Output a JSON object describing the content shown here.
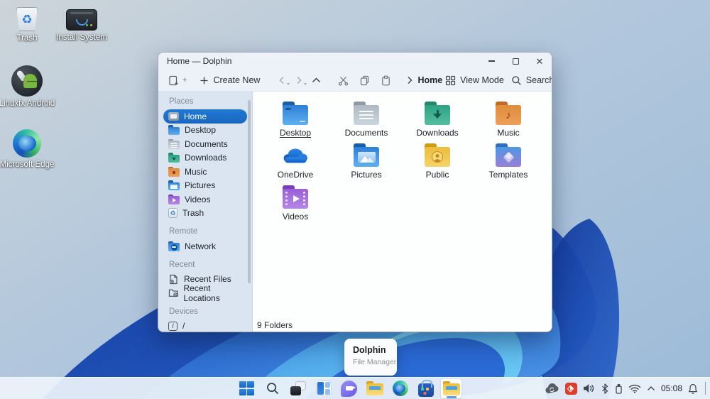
{
  "desktop": {
    "icons": [
      {
        "label": "Trash",
        "icon": "trash-icon"
      },
      {
        "label": "Install System",
        "icon": "install-system-icon"
      },
      {
        "label": "Linuxfx Android",
        "icon": "linuxfx-android-icon"
      },
      {
        "label": "Microsoft Edge",
        "icon": "edge-icon"
      }
    ]
  },
  "window": {
    "title": "Home — Dolphin",
    "controls": {
      "minimize": "minimize",
      "maximize": "maximize",
      "close": "close"
    },
    "toolbar": {
      "new_tab_icon": "new-folder-tab-icon",
      "create_new_label": "Create New",
      "nav_icons": [
        "back-chevron-icon",
        "forward-chevron-icon",
        "up-arrow-icon"
      ],
      "edit_icons": [
        "cut-scissors-icon",
        "copy-icon",
        "paste-icon"
      ],
      "breadcrumb": {
        "location": "Home"
      },
      "view_mode_label": "View Mode",
      "search_label": "Search",
      "menu_icon": "meatballs-menu-icon"
    },
    "sidebar": {
      "sections": [
        {
          "title": "Places",
          "items": [
            {
              "label": "Home",
              "icon": "home-icon",
              "selected": true
            },
            {
              "label": "Desktop",
              "icon": "folder-desktop-icon"
            },
            {
              "label": "Documents",
              "icon": "folder-documents-icon"
            },
            {
              "label": "Downloads",
              "icon": "folder-downloads-icon"
            },
            {
              "label": "Music",
              "icon": "folder-music-icon"
            },
            {
              "label": "Pictures",
              "icon": "folder-pictures-icon"
            },
            {
              "label": "Videos",
              "icon": "folder-videos-icon"
            },
            {
              "label": "Trash",
              "icon": "trash-small-icon"
            }
          ]
        },
        {
          "title": "Remote",
          "items": [
            {
              "label": "Network",
              "icon": "network-folder-icon"
            }
          ]
        },
        {
          "title": "Recent",
          "items": [
            {
              "label": "Recent Files",
              "icon": "recent-files-icon"
            },
            {
              "label": "Recent Locations",
              "icon": "recent-locations-icon"
            }
          ]
        },
        {
          "title": "Devices",
          "items": [
            {
              "label": "/",
              "icon": "root-drive-icon"
            }
          ]
        }
      ]
    },
    "content": {
      "folders": [
        {
          "label": "Desktop",
          "icon": "folder-desktop-icon",
          "focused": true
        },
        {
          "label": "Documents",
          "icon": "folder-documents-icon"
        },
        {
          "label": "Downloads",
          "icon": "folder-downloads-icon"
        },
        {
          "label": "Music",
          "icon": "folder-music-icon"
        },
        {
          "label": "OneDrive",
          "icon": "onedrive-cloud-icon"
        },
        {
          "label": "Pictures",
          "icon": "folder-pictures-icon"
        },
        {
          "label": "Public",
          "icon": "folder-public-icon"
        },
        {
          "label": "Templates",
          "icon": "folder-templates-icon"
        },
        {
          "label": "Videos",
          "icon": "folder-videos-icon"
        }
      ]
    },
    "statusbar": {
      "text": "9 Folders"
    }
  },
  "tooltip": {
    "title": "Dolphin",
    "subtitle": "File Manager"
  },
  "taskbar": {
    "buttons": [
      {
        "icon": "start-icon"
      },
      {
        "icon": "search-icon"
      },
      {
        "icon": "task-view-icon"
      },
      {
        "icon": "widgets-icon"
      },
      {
        "icon": "chat-icon"
      },
      {
        "icon": "file-explorer-icon"
      },
      {
        "icon": "edge-icon"
      },
      {
        "icon": "store-icon"
      },
      {
        "icon": "dolphin-icon",
        "active": true
      }
    ],
    "tray": {
      "icons": [
        "cloud-sync-icon",
        "anydesk-icon",
        "volume-icon",
        "bluetooth-icon",
        "usb-device-icon",
        "wifi-icon",
        "tray-expand-chevron-icon",
        "notification-bell-icon",
        "show-desktop-handle"
      ],
      "time": "05:08"
    }
  },
  "colors": {
    "accent": "#1c6fc9",
    "selection": "#1c6fc9",
    "taskbar_bg": "#edf3fa",
    "sidebar_bg": "#dbe5f2"
  }
}
